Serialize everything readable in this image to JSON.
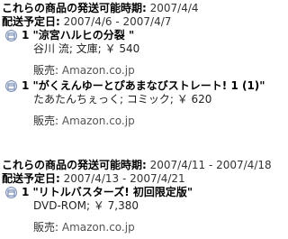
{
  "groups": [
    {
      "availability_label": "これらの商品の発送可能時期:",
      "availability_value": "2007/4/4",
      "delivery_label": "配送予定日:",
      "delivery_value": "2007/4/6 - 2007/4/7",
      "items": [
        {
          "quantity": "1",
          "title": "\"涼宮ハルヒの分裂 \"",
          "details": "谷川 流; 文庫; ￥ 540",
          "seller_label": "販売:",
          "seller": "Amazon.co.jp"
        },
        {
          "quantity": "1",
          "title": "\"がくえんゆーとぴあまなびストレート! 1 (1)\"",
          "details": "たあたんちぇっく; コミック; ￥ 620",
          "seller_label": "販売:",
          "seller": "Amazon.co.jp"
        }
      ]
    },
    {
      "availability_label": "これらの商品の発送可能時期:",
      "availability_value": "2007/4/11 - 2007/4/18",
      "delivery_label": "配送予定日:",
      "delivery_value": "2007/4/13 - 2007/4/21",
      "items": [
        {
          "quantity": "1",
          "title": "\"リトルバスターズ!  初回限定版\"",
          "details": "DVD-ROM; ￥ 7,380",
          "seller_label": "販売:",
          "seller": "Amazon.co.jp"
        }
      ]
    }
  ],
  "icons": {
    "item": "package-icon"
  }
}
